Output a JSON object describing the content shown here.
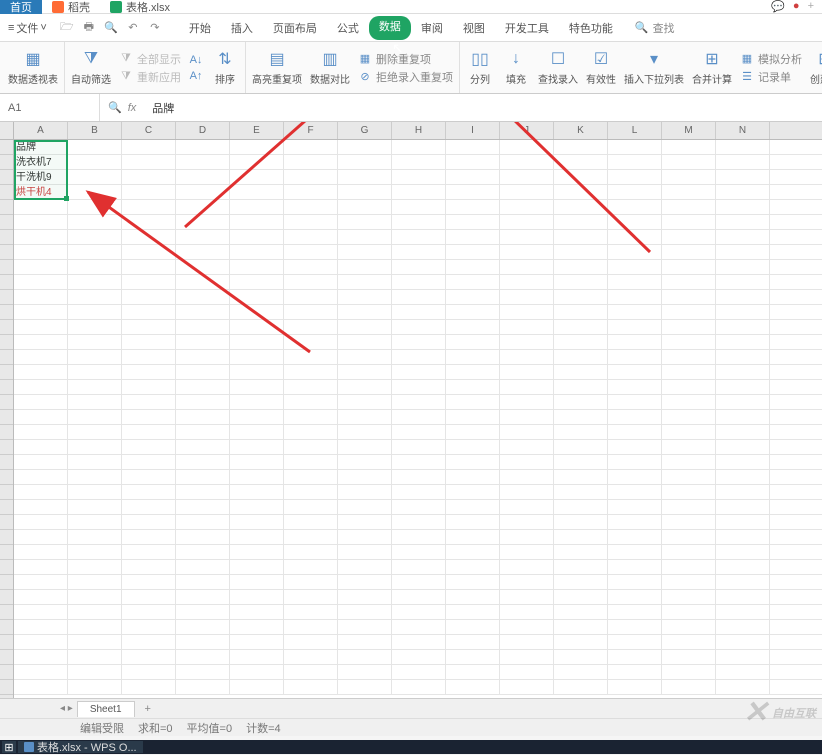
{
  "top_tabs": {
    "home": "首页",
    "daoke": "稻壳",
    "file": "表格.xlsx"
  },
  "menu": {
    "file_dropdown": "文件",
    "tabs": [
      "开始",
      "插入",
      "页面布局",
      "公式",
      "数据",
      "审阅",
      "视图",
      "开发工具",
      "特色功能"
    ],
    "active_index": 4,
    "search": "查找"
  },
  "ribbon": {
    "pivot": "数据透视表",
    "autofilter": "自动筛选",
    "show_all": "全部显示",
    "reapply": "重新应用",
    "sortasc_icon": "sort-asc-icon",
    "sortdesc_icon": "sort-desc-icon",
    "sort": "排序",
    "highlight_dup": "高亮重复项",
    "data_compare": "数据对比",
    "remove_dup": "删除重复项",
    "reject_dup": "拒绝录入重复项",
    "text_to_cols": "分列",
    "fill": "填充",
    "find_entry": "查找录入",
    "validity": "有效性",
    "insert_dropdown": "插入下拉列表",
    "consolidate": "合并计算",
    "sim_analysis": "模拟分析",
    "record_form": "记录单",
    "create": "创建组"
  },
  "formula_bar": {
    "cell_ref": "A1",
    "fx": "fx",
    "content": "品牌"
  },
  "columns": [
    "A",
    "B",
    "C",
    "D",
    "E",
    "F",
    "G",
    "H",
    "I",
    "J",
    "K",
    "L",
    "M",
    "N"
  ],
  "cell_data": {
    "a1": "品牌",
    "a2": "洗衣机7",
    "a3": "干洗机9",
    "a4": "烘干机4"
  },
  "sheet_tabs": {
    "sheet1": "Sheet1"
  },
  "status": {
    "edit": "编辑受限",
    "sum": "求和=0",
    "avg": "平均值=0",
    "count": "计数=4"
  },
  "watermark": "自由互联",
  "taskbar": {
    "file": "表格.xlsx - WPS O..."
  }
}
